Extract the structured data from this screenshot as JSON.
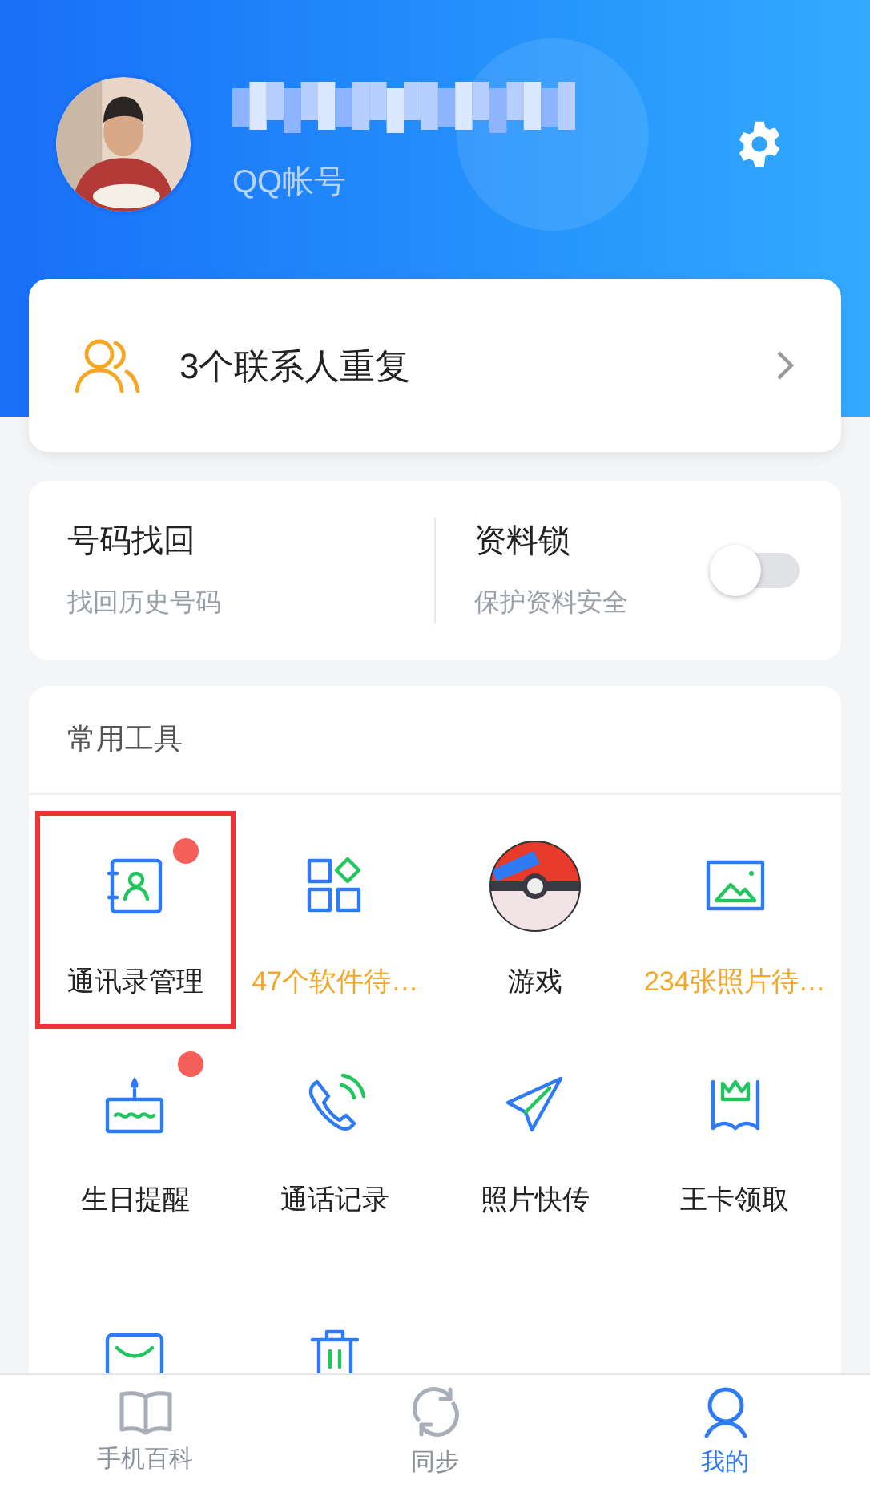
{
  "profile": {
    "account_label": "QQ帐号"
  },
  "duplicate_banner": {
    "text": "3个联系人重复"
  },
  "features": [
    {
      "kind": "link",
      "title": "号码找回",
      "subtitle": "找回历史号码"
    },
    {
      "kind": "toggle",
      "title": "资料锁",
      "subtitle": "保护资料安全",
      "on": false
    }
  ],
  "tools": {
    "title": "常用工具",
    "items": [
      {
        "kind": "contacts",
        "label": "通讯录管理",
        "badge": true,
        "alert": false,
        "highlighted": true
      },
      {
        "kind": "apps",
        "label": "47个软件待…",
        "badge": false,
        "alert": true,
        "highlighted": false
      },
      {
        "kind": "ball",
        "label": "游戏",
        "badge": false,
        "alert": false,
        "highlighted": false
      },
      {
        "label": "234张照片待…",
        "badge": false,
        "alert": true,
        "highlighted": false
      },
      {
        "kind": "cake",
        "label": "生日提醒",
        "badge": true,
        "alert": false,
        "highlighted": false
      },
      {
        "kind": "phone",
        "label": "通话记录",
        "badge": false,
        "alert": false,
        "highlighted": false
      },
      {
        "kind": "plane",
        "label": "照片快传",
        "badge": false,
        "alert": false,
        "highlighted": false
      },
      {
        "kind": "crown",
        "label": "王卡领取",
        "badge": false,
        "alert": false,
        "highlighted": false
      },
      {
        "kind": "mail",
        "badge": false,
        "highlighted": false
      },
      {
        "kind": "trash",
        "badge": false,
        "highlighted": false
      }
    ]
  },
  "bottom_nav": [
    {
      "kind": "book",
      "label": "手机百科",
      "selected": false
    },
    {
      "kind": "sync",
      "label": "同步",
      "selected": false
    },
    {
      "kind": "person",
      "label": "我的",
      "selected": true
    }
  ]
}
